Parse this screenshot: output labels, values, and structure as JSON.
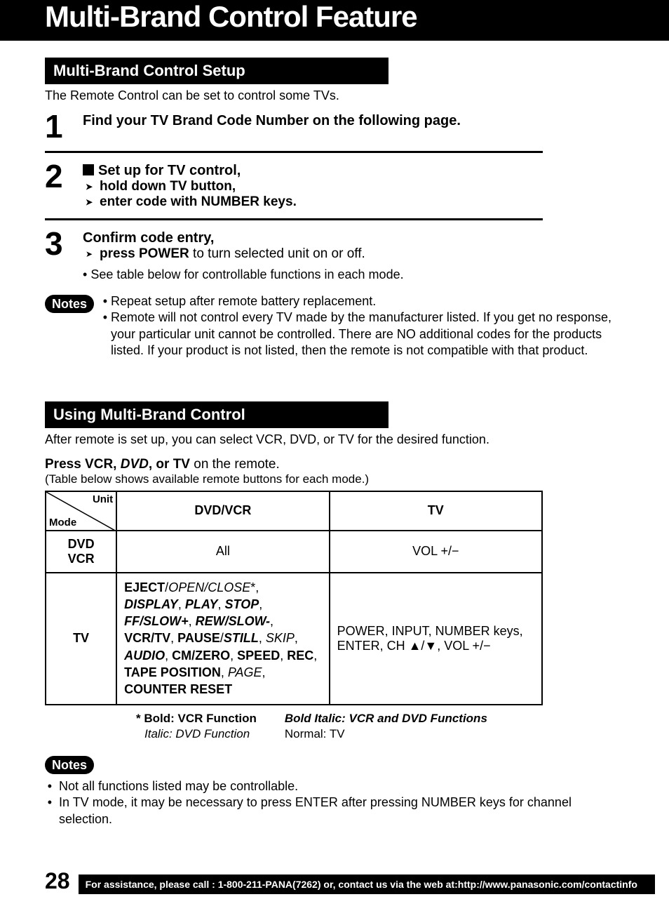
{
  "page_title": "Multi-Brand Control Feature",
  "section1": {
    "header": "Multi-Brand Control Setup",
    "intro": "The Remote Control can be set to control some TVs.",
    "step1_num": "1",
    "step1_text": "Find your TV Brand Code Number on the following page.",
    "step2_num": "2",
    "step2_title": "Set up for TV control,",
    "step2_line1": "hold down TV button,",
    "step2_line2": "enter code with NUMBER keys.",
    "step3_num": "3",
    "step3_title": "Confirm code entry,",
    "step3_line1a": "press POWER",
    "step3_line1b": " to turn selected unit on or off.",
    "step3_line2": "See table below for controllable functions in each mode.",
    "notes_label": "Notes",
    "notes_b1": "Repeat setup after remote battery replacement.",
    "notes_b2": "Remote will not control every TV made by the manufacturer listed. If you get no response, your particular unit cannot be controlled. There are NO additional codes for the products listed. If your product is not listed, then the remote is not compatible with that product."
  },
  "section2": {
    "header": "Using Multi-Brand Control",
    "intro": "After remote is set up, you can select VCR, DVD, or TV for the desired function.",
    "press_bold1": "Press VCR, ",
    "press_bi": "DVD",
    "press_bold2": ", or TV",
    "press_rest": " on the remote.",
    "paren": "(Table below shows available remote buttons for each mode.)",
    "table": {
      "unit_label": "Unit",
      "mode_label": "Mode",
      "col_dvdvcr": "DVD/VCR",
      "col_tv": "TV",
      "row1_head": "DVD VCR",
      "row1_c1": "All",
      "row1_c2": "VOL +/−",
      "row2_head": "TV",
      "row2_c1_parts": [
        {
          "t": "EJECT",
          "c": "b"
        },
        {
          "t": "/",
          "c": ""
        },
        {
          "t": "OPEN/CLOSE",
          "c": "i"
        },
        {
          "t": "*,",
          "c": ""
        },
        {
          "t": "\n",
          "c": ""
        },
        {
          "t": "DISPLAY",
          "c": "bi"
        },
        {
          "t": ", ",
          "c": ""
        },
        {
          "t": "PLAY",
          "c": "bi"
        },
        {
          "t": ", ",
          "c": ""
        },
        {
          "t": "STOP",
          "c": "bi"
        },
        {
          "t": ",",
          "c": ""
        },
        {
          "t": "\n",
          "c": ""
        },
        {
          "t": "FF/SLOW+",
          "c": "bi"
        },
        {
          "t": ", ",
          "c": ""
        },
        {
          "t": "REW/SLOW-",
          "c": "bi"
        },
        {
          "t": ",",
          "c": ""
        },
        {
          "t": "\n",
          "c": ""
        },
        {
          "t": "VCR/TV",
          "c": "b"
        },
        {
          "t": ", ",
          "c": ""
        },
        {
          "t": "PAUSE",
          "c": "b"
        },
        {
          "t": "/",
          "c": ""
        },
        {
          "t": "STILL",
          "c": "bi"
        },
        {
          "t": ", ",
          "c": ""
        },
        {
          "t": "SKIP",
          "c": "i"
        },
        {
          "t": ",",
          "c": ""
        },
        {
          "t": "\n",
          "c": ""
        },
        {
          "t": "AUDIO",
          "c": "bi"
        },
        {
          "t": ", ",
          "c": ""
        },
        {
          "t": "CM/ZERO",
          "c": "b"
        },
        {
          "t": ", ",
          "c": ""
        },
        {
          "t": "SPEED",
          "c": "b"
        },
        {
          "t": ", ",
          "c": ""
        },
        {
          "t": "REC",
          "c": "b"
        },
        {
          "t": ",",
          "c": ""
        },
        {
          "t": "\n",
          "c": ""
        },
        {
          "t": "TAPE POSITION",
          "c": "b"
        },
        {
          "t": ", ",
          "c": ""
        },
        {
          "t": "PAGE",
          "c": "i"
        },
        {
          "t": ",",
          "c": ""
        },
        {
          "t": "\n",
          "c": ""
        },
        {
          "t": "COUNTER RESET",
          "c": "b"
        }
      ],
      "row2_c2": "POWER, INPUT, NUMBER keys, ENTER, CH ▲/▼, VOL +/−"
    },
    "legend": {
      "star": "*",
      "l1": "Bold: VCR Function",
      "l2": "Italic: DVD Function",
      "r1": "Bold Italic: VCR and DVD Functions",
      "r2": "Normal: TV"
    },
    "notes_label": "Notes",
    "bn1": "Not all functions listed may be controllable.",
    "bn2": "In TV mode, it may be necessary to press ENTER after pressing NUMBER keys for channel selection."
  },
  "footer": {
    "page_num": "28",
    "text": "For assistance, please call : 1-800-211-PANA(7262) or, contact us via the web at:http://www.panasonic.com/contactinfo"
  }
}
